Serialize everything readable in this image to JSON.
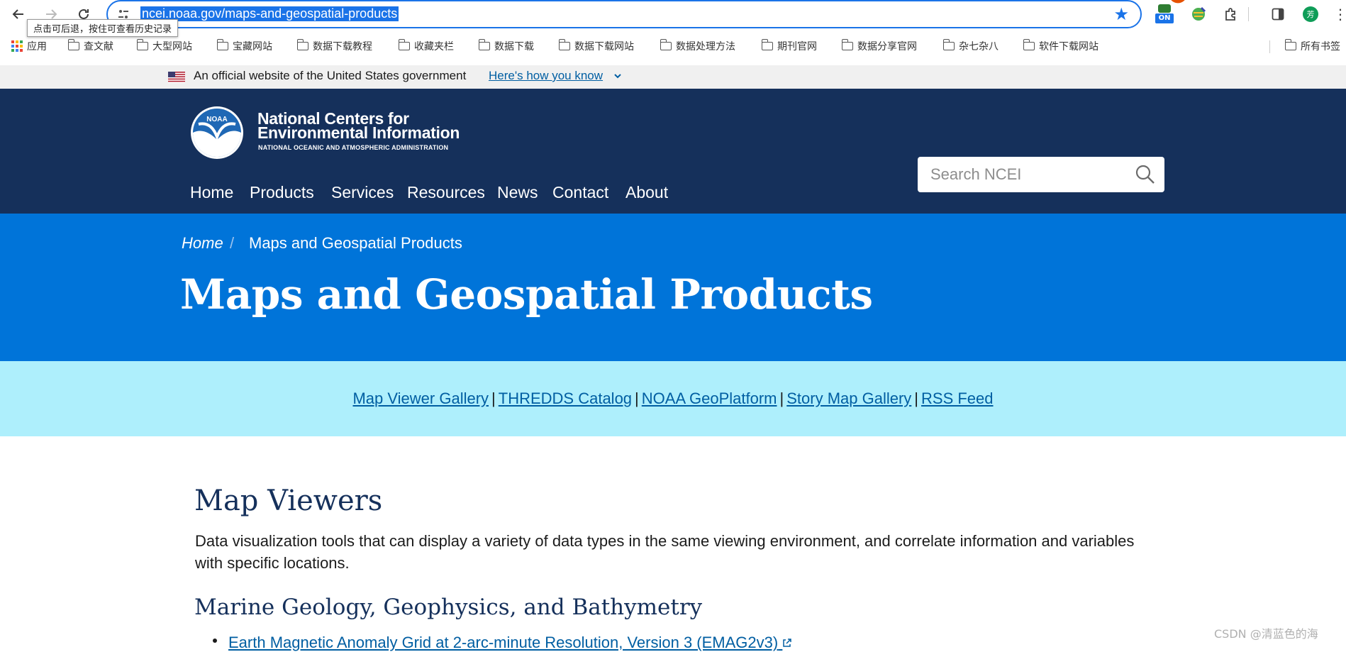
{
  "browser": {
    "url": "ncei.noaa.gov/maps-and-geospatial-products",
    "back_tooltip": "点击可后退，按住可查看历史记录",
    "profile_initial": "芳",
    "ext_badge": "ON"
  },
  "bookmarks": {
    "apps_label": "应用",
    "items": [
      "查文献",
      "大型网站",
      "宝藏网站",
      "数据下载教程",
      "收藏夹栏",
      "数据下载",
      "数据下载网站",
      "数据处理方法",
      "期刊官网",
      "数据分享官网",
      "杂七杂八",
      "软件下载网站"
    ],
    "overflow_label": "所有书签"
  },
  "gov_banner": {
    "text": "An official website of the United States government",
    "link": "Here's how you know"
  },
  "header": {
    "logo_text": "NOAA",
    "title_line1": "National Centers for",
    "title_line2": "Environmental Information",
    "subtitle": "NATIONAL OCEANIC AND ATMOSPHERIC ADMINISTRATION",
    "nav": [
      "Home",
      "Products",
      "Services",
      "Resources",
      "News",
      "Contact",
      "About"
    ],
    "search_placeholder": "Search NCEI"
  },
  "breadcrumb": {
    "home": "Home",
    "separator": "/",
    "current": "Maps and Geospatial Products"
  },
  "page_title": "Maps and Geospatial Products",
  "quick_links": [
    "Map Viewer Gallery",
    "THREDDS Catalog",
    "NOAA GeoPlatform",
    "Story Map Gallery",
    "RSS Feed"
  ],
  "quick_links_sep": "|",
  "content": {
    "section_title": "Map Viewers",
    "section_desc": "Data visualization tools that can display a variety of data types in the same viewing environment, and correlate information and variables with specific locations.",
    "subsection_title": "Marine Geology, Geophysics, and Bathymetry",
    "list_items": [
      "Earth Magnetic Anomaly Grid at 2-arc-minute Resolution, Version 3 (EMAG2v3)"
    ]
  },
  "watermark": "CSDN @清蓝色的海",
  "colors": {
    "header_bg": "#15305b",
    "hero_bg": "#0074d9",
    "quicklinks_bg": "#aeeffc",
    "link": "#005ea2"
  }
}
